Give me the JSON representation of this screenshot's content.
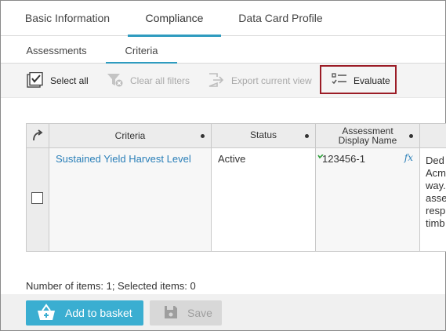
{
  "tabs": [
    {
      "label": "Basic Information"
    },
    {
      "label": "Compliance"
    },
    {
      "label": "Data Card Profile"
    }
  ],
  "subtabs": [
    {
      "label": "Assessments"
    },
    {
      "label": "Criteria"
    }
  ],
  "active_tab": "Compliance",
  "active_subtab": "Criteria",
  "toolbar": {
    "select_all": "Select all",
    "clear_filters": "Clear all filters",
    "export_view": "Export current view",
    "evaluate": "Evaluate"
  },
  "grid": {
    "columns": [
      "Criteria",
      "Status",
      "Assessment Display Name"
    ],
    "column_assessment_line1": "Assessment",
    "column_assessment_line2": "Display Name",
    "rows": [
      {
        "criteria": "Sustained Yield Harvest Level",
        "status": "Active",
        "assessment_display_name": "123456-1",
        "formula_icon": "fx",
        "description_fragment": [
          "Ded",
          "Acm",
          "way.",
          "asse",
          "resp",
          "timb"
        ]
      }
    ]
  },
  "footer": {
    "count_text": "Number of items: 1; Selected items: 0"
  },
  "actions": {
    "add_to_basket": "Add to basket",
    "save": "Save"
  },
  "colors": {
    "accent": "#2e9bbf",
    "button_primary": "#3aaed1",
    "highlight_box": "#9b1c26",
    "link": "#2a7fb8"
  }
}
